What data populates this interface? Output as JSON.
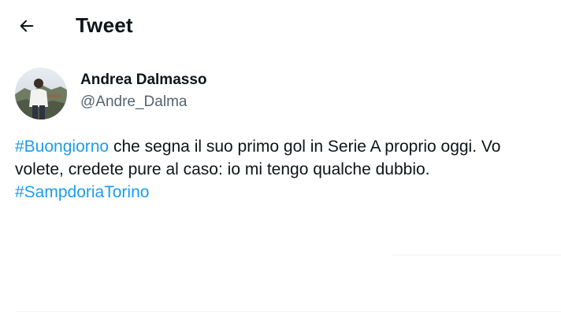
{
  "header": {
    "title": "Tweet"
  },
  "author": {
    "display_name": "Andrea Dalmasso",
    "handle": "@Andre_Dalma"
  },
  "tweet": {
    "hashtag_1": "#Buongiorno",
    "line_1_rest": " che segna il suo primo gol in Serie A proprio oggi. Vo",
    "line_2": "volete, credete pure al caso: io mi tengo qualche dubbio.",
    "hashtag_2": "#SampdoriaTorino"
  },
  "colors": {
    "hashtag": "#1d9bf0",
    "handle": "#536471",
    "text": "#0f1419"
  },
  "icons": {
    "back": "arrow-left-icon"
  }
}
